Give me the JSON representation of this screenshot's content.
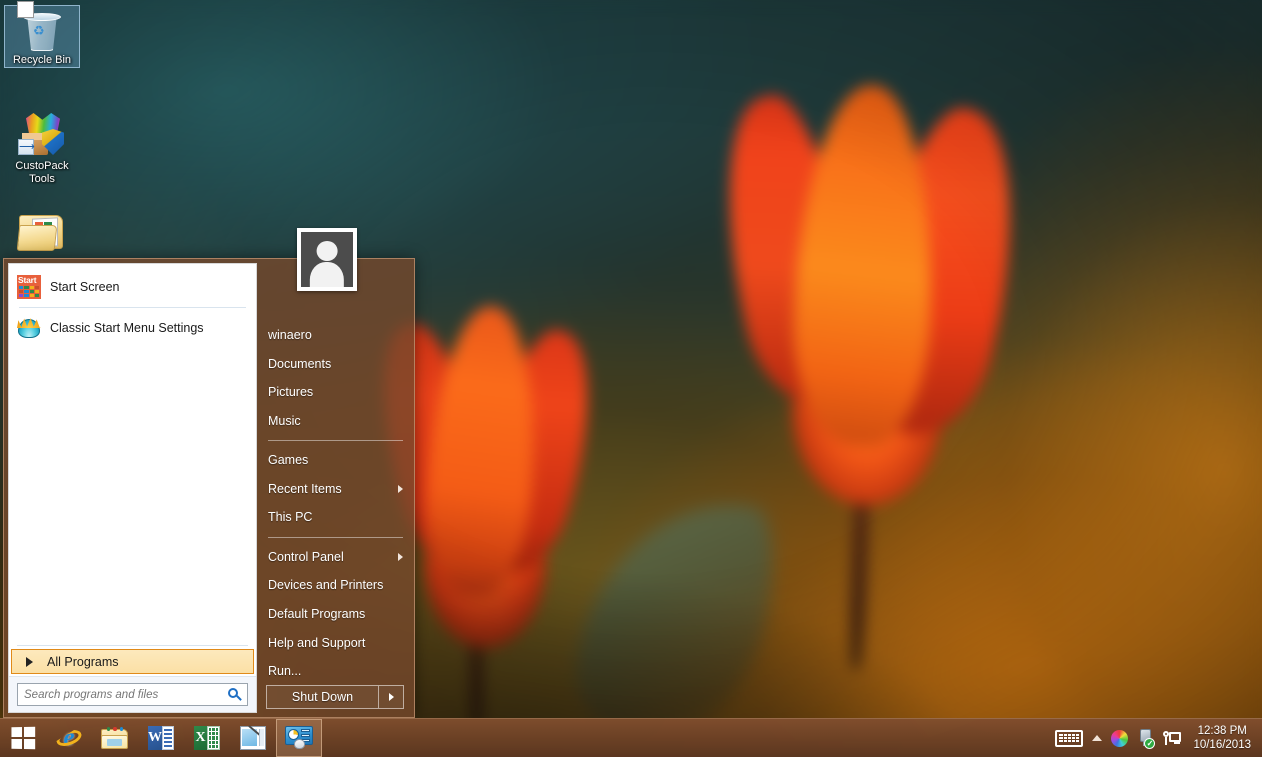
{
  "desktop": {
    "icons": [
      {
        "name": "Recycle Bin",
        "icon": "recycle-bin-icon",
        "selected": true
      },
      {
        "name": "CustoPack Tools",
        "icon": "custopack-tools-icon",
        "selected": false
      },
      {
        "name": "",
        "icon": "folder-icon",
        "selected": false
      }
    ]
  },
  "start_menu": {
    "programs": [
      {
        "label": "Start Screen",
        "icon": "start-screen-tile-icon"
      },
      {
        "label": "Classic Start Menu Settings",
        "icon": "classic-shell-icon"
      }
    ],
    "all_programs_label": "All Programs",
    "search": {
      "placeholder": "Search programs and files",
      "value": "",
      "icon": "search-icon"
    },
    "user": {
      "name": "winaero",
      "avatar_icon": "user-avatar-icon"
    },
    "right_groups": [
      [
        {
          "label": "winaero",
          "submenu": false
        },
        {
          "label": "Documents",
          "submenu": false
        },
        {
          "label": "Pictures",
          "submenu": false
        },
        {
          "label": "Music",
          "submenu": false
        }
      ],
      [
        {
          "label": "Games",
          "submenu": false
        },
        {
          "label": "Recent Items",
          "submenu": true
        },
        {
          "label": "This PC",
          "submenu": false
        }
      ],
      [
        {
          "label": "Control Panel",
          "submenu": true
        },
        {
          "label": "Devices and Printers",
          "submenu": false
        },
        {
          "label": "Default Programs",
          "submenu": false
        },
        {
          "label": "Help and Support",
          "submenu": false
        },
        {
          "label": "Run...",
          "submenu": false
        }
      ]
    ],
    "shutdown": {
      "label": "Shut Down",
      "arrow_icon": "chevron-right-icon"
    }
  },
  "taskbar": {
    "buttons": [
      {
        "name": "start-button",
        "icon": "windows-logo-icon",
        "active": false
      },
      {
        "name": "internet-explorer",
        "icon": "internet-explorer-icon",
        "active": false
      },
      {
        "name": "file-explorer",
        "icon": "file-explorer-icon",
        "active": false
      },
      {
        "name": "word",
        "icon": "microsoft-word-icon",
        "active": false
      },
      {
        "name": "excel",
        "icon": "microsoft-excel-icon",
        "active": false
      },
      {
        "name": "paint",
        "icon": "paint-icon",
        "active": false
      },
      {
        "name": "control-panel",
        "icon": "control-panel-icon",
        "active": true
      }
    ],
    "tray": {
      "icons": [
        {
          "name": "touch-keyboard-icon"
        },
        {
          "name": "show-hidden-icons-chevron"
        },
        {
          "name": "color-wheel-icon"
        },
        {
          "name": "safely-remove-hardware-icon"
        },
        {
          "name": "network-icon"
        }
      ],
      "clock": {
        "time": "12:38 PM",
        "date": "10/16/2013"
      }
    }
  },
  "colors": {
    "taskbar": "#6e4226",
    "menu_frame": "#76482c",
    "accent_orange": "#e08a19",
    "all_programs_bg": "#fbe0a6",
    "start_tile": "#e8603c"
  }
}
